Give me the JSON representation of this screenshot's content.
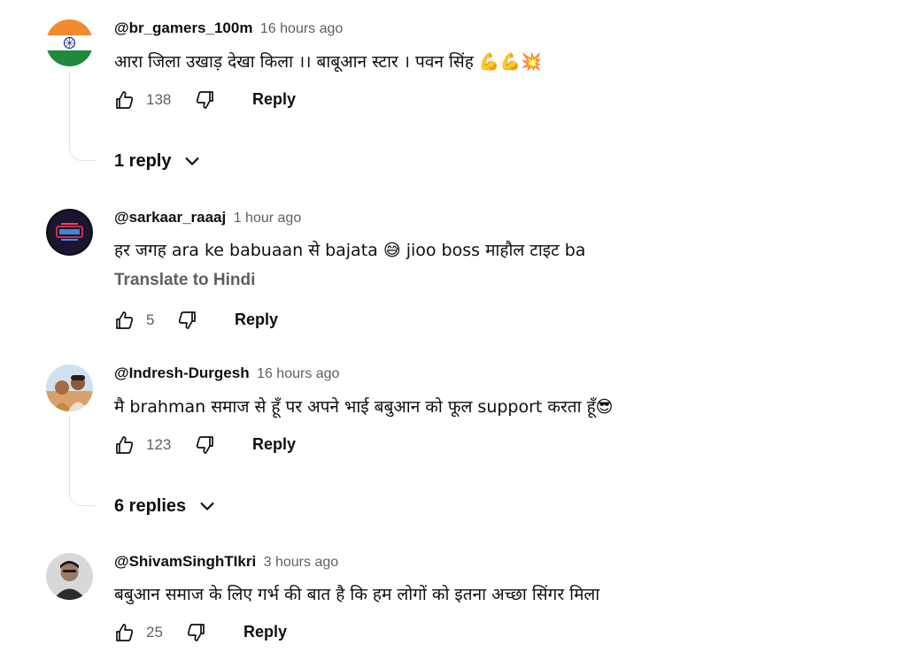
{
  "comments": [
    {
      "author": "@br_gamers_100m",
      "time": "16 hours ago",
      "text": "आरा जिला उखाड़ देखा किला ।। बाबूआन स्टार । पवन सिंह",
      "emoji": "💪💪💥",
      "likes": "138",
      "reply_label": "Reply",
      "replies_label": "1 reply",
      "avatar": "india-flag"
    },
    {
      "author": "@sarkaar_raaaj",
      "time": "1 hour ago",
      "text": "हर जगह ara ke babuaan से bajata",
      "emoji": "😅",
      "text_after": "jioo boss माहौल टाइट ba",
      "translate_label": "Translate to Hindi",
      "likes": "5",
      "reply_label": "Reply",
      "avatar": "neon-logo"
    },
    {
      "author": "@Indresh-Durgesh",
      "time": "16 hours ago",
      "text": "मै brahman समाज से हूँ पर अपने भाई बबुआन को फूल support करता हूँ",
      "emoji": "😎",
      "likes": "123",
      "reply_label": "Reply",
      "replies_label": "6 replies",
      "avatar": "two-people-photo"
    },
    {
      "author": "@ShivamSinghTIkri",
      "time": "3 hours ago",
      "text": "बबुआन समाज के लिए गर्भ की बात है कि हम लोगों को इतना अच्छा सिंगर मिला",
      "likes": "25",
      "reply_label": "Reply",
      "avatar": "person-photo"
    }
  ],
  "icons": {
    "like": "thumbs-up-icon",
    "dislike": "thumbs-down-icon",
    "expand": "chevron-down-icon"
  },
  "colors": {
    "text_primary": "#0f0f0f",
    "text_secondary": "#606060",
    "thread_line": "#e5e5e5"
  }
}
